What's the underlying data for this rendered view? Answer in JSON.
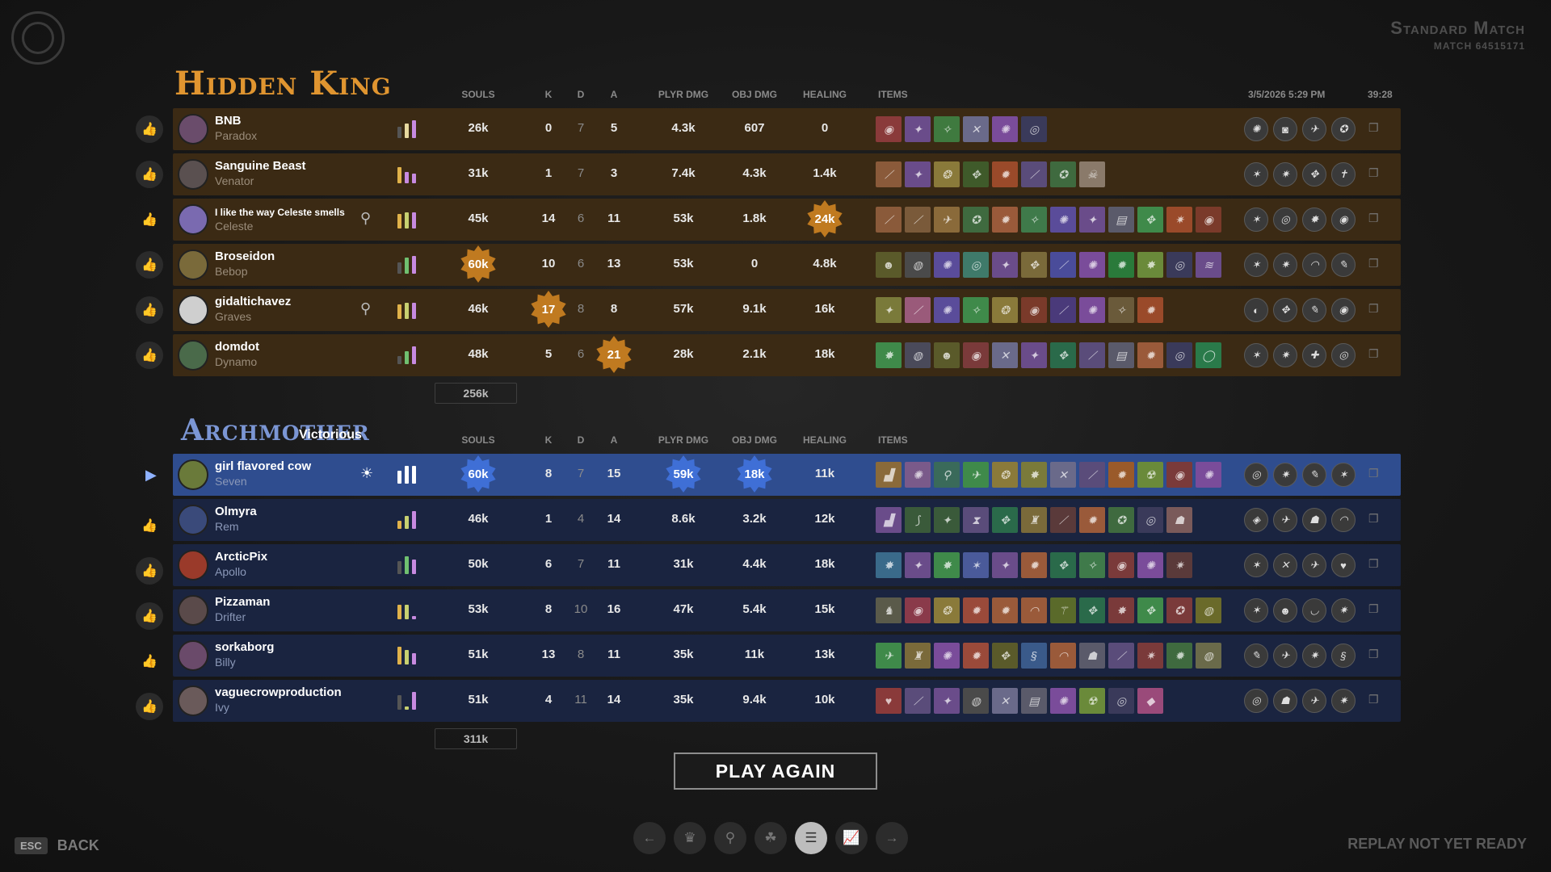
{
  "match": {
    "title": "Standard Match",
    "id": "MATCH 64515171",
    "date": "3/5/2026 5:29 PM",
    "duration": "39:28"
  },
  "headers": {
    "souls": "SOULS",
    "k": "K",
    "d": "D",
    "a": "A",
    "plyr": "PLYR DMG",
    "obj": "OBJ DMG",
    "heal": "HEALING",
    "items": "ITEMS"
  },
  "team1": {
    "name": "Hidden King",
    "total_souls": "256k",
    "players": [
      {
        "name": "BNB",
        "hero": "Paradox",
        "souls": "26k",
        "k": "0",
        "d": "7",
        "a": "5",
        "plyr": "4.3k",
        "obj": "607",
        "heal": "0"
      },
      {
        "name": "Sanguine Beast",
        "hero": "Venator",
        "souls": "31k",
        "k": "1",
        "d": "7",
        "a": "3",
        "plyr": "7.4k",
        "obj": "4.3k",
        "heal": "1.4k"
      },
      {
        "name": "I like the way Celeste smells",
        "hero": "Celeste",
        "souls": "45k",
        "k": "14",
        "d": "6",
        "a": "11",
        "plyr": "53k",
        "obj": "1.8k",
        "heal": "24k"
      },
      {
        "name": "Broseidon",
        "hero": "Bebop",
        "souls": "60k",
        "k": "10",
        "d": "6",
        "a": "13",
        "plyr": "53k",
        "obj": "0",
        "heal": "4.8k"
      },
      {
        "name": "gidaltichavez",
        "hero": "Graves",
        "souls": "46k",
        "k": "17",
        "d": "8",
        "a": "8",
        "plyr": "57k",
        "obj": "9.1k",
        "heal": "16k"
      },
      {
        "name": "domdot",
        "hero": "Dynamo",
        "souls": "48k",
        "k": "5",
        "d": "6",
        "a": "21",
        "plyr": "28k",
        "obj": "2.1k",
        "heal": "18k"
      }
    ]
  },
  "team2": {
    "name": "Archmother",
    "result": "Victorious",
    "total_souls": "311k",
    "players": [
      {
        "name": "girl flavored cow",
        "hero": "Seven",
        "souls": "60k",
        "k": "8",
        "d": "7",
        "a": "15",
        "plyr": "59k",
        "obj": "18k",
        "heal": "11k"
      },
      {
        "name": "Olmyra",
        "hero": "Rem",
        "souls": "46k",
        "k": "1",
        "d": "4",
        "a": "14",
        "plyr": "8.6k",
        "obj": "3.2k",
        "heal": "12k"
      },
      {
        "name": "ArcticPix",
        "hero": "Apollo",
        "souls": "50k",
        "k": "6",
        "d": "7",
        "a": "11",
        "plyr": "31k",
        "obj": "4.4k",
        "heal": "18k"
      },
      {
        "name": "Pizzaman",
        "hero": "Drifter",
        "souls": "53k",
        "k": "8",
        "d": "10",
        "a": "16",
        "plyr": "47k",
        "obj": "5.4k",
        "heal": "15k"
      },
      {
        "name": "sorkaborg",
        "hero": "Billy",
        "souls": "51k",
        "k": "13",
        "d": "8",
        "a": "11",
        "plyr": "35k",
        "obj": "11k",
        "heal": "13k"
      },
      {
        "name": "vaguecrowproduction",
        "hero": "Ivy",
        "souls": "51k",
        "k": "4",
        "d": "11",
        "a": "14",
        "plyr": "35k",
        "obj": "9.4k",
        "heal": "10k"
      }
    ]
  },
  "buttons": {
    "play_again": "PLAY AGAIN",
    "esc": "ESC",
    "back": "BACK"
  },
  "status": {
    "replay": "REPLAY NOT YET READY"
  },
  "colors": {
    "hidden_king": "#e09530",
    "archmother": "#7b96d4",
    "hk_row": "#3b2a14",
    "am_row": "#1a2440",
    "selected_row": "#2f4d8f"
  }
}
